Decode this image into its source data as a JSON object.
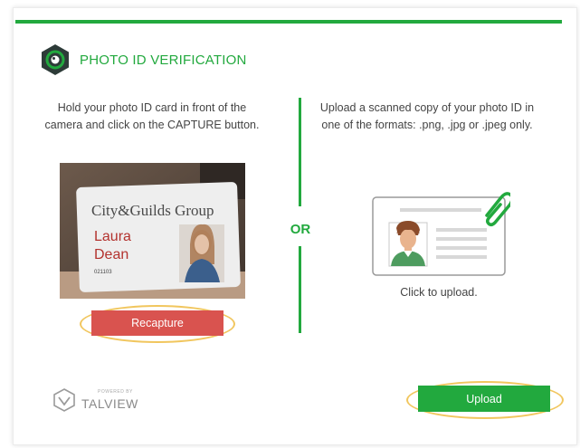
{
  "colors": {
    "accent": "#22a93e",
    "danger": "#d9534f",
    "highlight_ring": "#f1c65e",
    "logo_dark": "#2d3b38"
  },
  "header": {
    "title": "PHOTO ID VERIFICATION",
    "icon": "camera-lens-icon"
  },
  "capture": {
    "instructions": "Hold your photo ID card in front of the camera and click on the CAPTURE button.",
    "card_org": "City&Guilds Group",
    "card_first_name": "Laura",
    "card_last_name": "Dean",
    "card_number": "021103",
    "recapture_label": "Recapture"
  },
  "divider": {
    "or_label": "OR"
  },
  "upload": {
    "instructions": "Upload a scanned copy of your photo ID in one of the formats: .png, .jpg or .jpeg only.",
    "illustration_icon": "id-card-paperclip-icon",
    "click_label": "Click to upload.",
    "upload_label": "Upload"
  },
  "footer": {
    "powered_by": "POWERED BY",
    "brand": "TALVIEW",
    "icon": "talview-logo-icon"
  }
}
